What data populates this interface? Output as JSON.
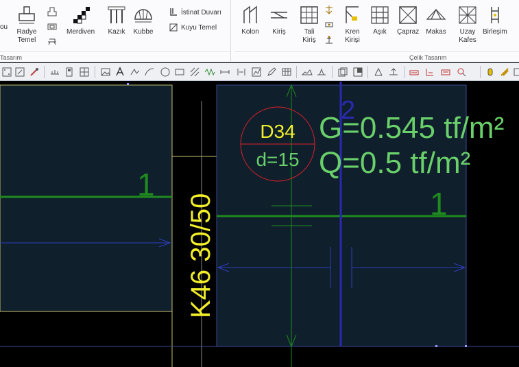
{
  "ribbon": {
    "left_group": {
      "label": "Tasarım",
      "partial_label": "ou",
      "buttons": [
        {
          "label_1": "Radye",
          "label_2": "Temel"
        },
        {
          "label_1": "Merdiven"
        },
        {
          "label_1": "Kazık"
        },
        {
          "label_1": "Kubbe"
        }
      ],
      "small_buttons": [
        {
          "label": "İstinat Duvarı"
        },
        {
          "label": "Kuyu Temel"
        }
      ]
    },
    "steel_group": {
      "label": "Çelik Tasarım",
      "buttons": [
        {
          "label_1": "Kolon"
        },
        {
          "label_1": "Kiriş"
        },
        {
          "label_1": "Tali",
          "label_2": "Kiriş"
        },
        {
          "label_1": "Kren",
          "label_2": "Kirişi"
        },
        {
          "label_1": "Aşık"
        },
        {
          "label_1": "Çapraz"
        },
        {
          "label_1": "Makas"
        },
        {
          "label_1": "Uzay",
          "label_2": "Kafes"
        },
        {
          "label_1": "Birleşim"
        }
      ]
    }
  },
  "toolbar": {
    "icons": [
      "grid-dots-icon",
      "snap-icon",
      "ruler-icon",
      "node-icon",
      "image-icon",
      "text-icon",
      "polyline-icon",
      "arc-icon",
      "circle-icon",
      "rectangle-icon",
      "hatch-icon",
      "wave-icon",
      "dimension-icon",
      "section-icon",
      "chart-icon",
      "edit-icon",
      "table-icon",
      "terrain-icon",
      "view-icon",
      "window-icon",
      "layers-icon",
      "move-icon",
      "copy-icon",
      "mirror-icon",
      "label-icon",
      "zoom-icon",
      "align-icon",
      "lock-icon"
    ]
  },
  "canvas": {
    "slab_id": "D34",
    "slab_thickness": "d=15",
    "dead_load": "G=0.545 tf/m²",
    "live_load": "Q=0.5 tf/m²",
    "axis_label_blue": "2",
    "axis_label_left": "1",
    "axis_label_right": "1",
    "beam_label": "K46 30/50",
    "colors": {
      "background": "#000000",
      "slab_fill": "#0f1f2c",
      "axis_green": "#1f8a1f",
      "load_text": "#6ad06a",
      "beam_yellow": "#f2ee2a",
      "slab_circle": "#e0202a",
      "axis_blue": "#2a2ab0",
      "dim_blue": "#2f3fc0"
    }
  }
}
